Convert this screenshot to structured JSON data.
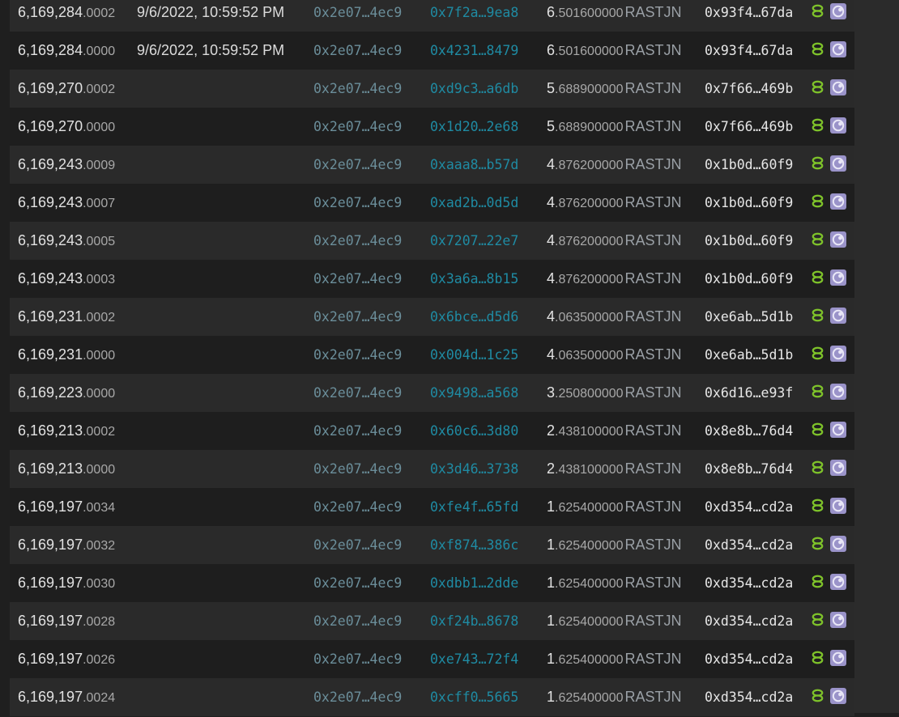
{
  "rows": [
    {
      "block_main": "6,169,284",
      "block_sub": ".0002",
      "time": "9/6/2022, 10:59:52 PM",
      "from": "0x2e07…4ec9",
      "hash": "0x7f2a…9ea8",
      "amount_int": "6",
      "amount_dec": ".501600000",
      "token": "RASTJN",
      "to": "0x93f4…67da"
    },
    {
      "block_main": "6,169,284",
      "block_sub": ".0000",
      "time": "9/6/2022, 10:59:52 PM",
      "from": "0x2e07…4ec9",
      "hash": "0x4231…8479",
      "amount_int": "6",
      "amount_dec": ".501600000",
      "token": "RASTJN",
      "to": "0x93f4…67da"
    },
    {
      "block_main": "6,169,270",
      "block_sub": ".0002",
      "time": "",
      "from": "0x2e07…4ec9",
      "hash": "0xd9c3…a6db",
      "amount_int": "5",
      "amount_dec": ".688900000",
      "token": "RASTJN",
      "to": "0x7f66…469b"
    },
    {
      "block_main": "6,169,270",
      "block_sub": ".0000",
      "time": "",
      "from": "0x2e07…4ec9",
      "hash": "0x1d20…2e68",
      "amount_int": "5",
      "amount_dec": ".688900000",
      "token": "RASTJN",
      "to": "0x7f66…469b"
    },
    {
      "block_main": "6,169,243",
      "block_sub": ".0009",
      "time": "",
      "from": "0x2e07…4ec9",
      "hash": "0xaaa8…b57d",
      "amount_int": "4",
      "amount_dec": ".876200000",
      "token": "RASTJN",
      "to": "0x1b0d…60f9"
    },
    {
      "block_main": "6,169,243",
      "block_sub": ".0007",
      "time": "",
      "from": "0x2e07…4ec9",
      "hash": "0xad2b…0d5d",
      "amount_int": "4",
      "amount_dec": ".876200000",
      "token": "RASTJN",
      "to": "0x1b0d…60f9"
    },
    {
      "block_main": "6,169,243",
      "block_sub": ".0005",
      "time": "",
      "from": "0x2e07…4ec9",
      "hash": "0x7207…22e7",
      "amount_int": "4",
      "amount_dec": ".876200000",
      "token": "RASTJN",
      "to": "0x1b0d…60f9"
    },
    {
      "block_main": "6,169,243",
      "block_sub": ".0003",
      "time": "",
      "from": "0x2e07…4ec9",
      "hash": "0x3a6a…8b15",
      "amount_int": "4",
      "amount_dec": ".876200000",
      "token": "RASTJN",
      "to": "0x1b0d…60f9"
    },
    {
      "block_main": "6,169,231",
      "block_sub": ".0002",
      "time": "",
      "from": "0x2e07…4ec9",
      "hash": "0x6bce…d5d6",
      "amount_int": "4",
      "amount_dec": ".063500000",
      "token": "RASTJN",
      "to": "0xe6ab…5d1b"
    },
    {
      "block_main": "6,169,231",
      "block_sub": ".0000",
      "time": "",
      "from": "0x2e07…4ec9",
      "hash": "0x004d…1c25",
      "amount_int": "4",
      "amount_dec": ".063500000",
      "token": "RASTJN",
      "to": "0xe6ab…5d1b"
    },
    {
      "block_main": "6,169,223",
      "block_sub": ".0000",
      "time": "",
      "from": "0x2e07…4ec9",
      "hash": "0x9498…a568",
      "amount_int": "3",
      "amount_dec": ".250800000",
      "token": "RASTJN",
      "to": "0x6d16…e93f"
    },
    {
      "block_main": "6,169,213",
      "block_sub": ".0002",
      "time": "",
      "from": "0x2e07…4ec9",
      "hash": "0x60c6…3d80",
      "amount_int": "2",
      "amount_dec": ".438100000",
      "token": "RASTJN",
      "to": "0x8e8b…76d4"
    },
    {
      "block_main": "6,169,213",
      "block_sub": ".0000",
      "time": "",
      "from": "0x2e07…4ec9",
      "hash": "0x3d46…3738",
      "amount_int": "2",
      "amount_dec": ".438100000",
      "token": "RASTJN",
      "to": "0x8e8b…76d4"
    },
    {
      "block_main": "6,169,197",
      "block_sub": ".0034",
      "time": "",
      "from": "0x2e07…4ec9",
      "hash": "0xfe4f…65fd",
      "amount_int": "1",
      "amount_dec": ".625400000",
      "token": "RASTJN",
      "to": "0xd354…cd2a"
    },
    {
      "block_main": "6,169,197",
      "block_sub": ".0032",
      "time": "",
      "from": "0x2e07…4ec9",
      "hash": "0xf874…386c",
      "amount_int": "1",
      "amount_dec": ".625400000",
      "token": "RASTJN",
      "to": "0xd354…cd2a"
    },
    {
      "block_main": "6,169,197",
      "block_sub": ".0030",
      "time": "",
      "from": "0x2e07…4ec9",
      "hash": "0xdbb1…2dde",
      "amount_int": "1",
      "amount_dec": ".625400000",
      "token": "RASTJN",
      "to": "0xd354…cd2a"
    },
    {
      "block_main": "6,169,197",
      "block_sub": ".0028",
      "time": "",
      "from": "0x2e07…4ec9",
      "hash": "0xf24b…8678",
      "amount_int": "1",
      "amount_dec": ".625400000",
      "token": "RASTJN",
      "to": "0xd354…cd2a"
    },
    {
      "block_main": "6,169,197",
      "block_sub": ".0026",
      "time": "",
      "from": "0x2e07…4ec9",
      "hash": "0xe743…72f4",
      "amount_int": "1",
      "amount_dec": ".625400000",
      "token": "RASTJN",
      "to": "0xd354…cd2a"
    },
    {
      "block_main": "6,169,197",
      "block_sub": ".0024",
      "time": "",
      "from": "0x2e07…4ec9",
      "hash": "0xcff0…5665",
      "amount_int": "1",
      "amount_dec": ".625400000",
      "token": "RASTJN",
      "to": "0xd354…cd2a"
    }
  ],
  "icons": {
    "link": "link-icon",
    "app": "app-icon"
  },
  "colors": {
    "link_icon": "#7ec22a",
    "app_icon": "#9a93c9",
    "hash_link": "#1f8ba3",
    "from_addr": "#6b8e9a"
  }
}
